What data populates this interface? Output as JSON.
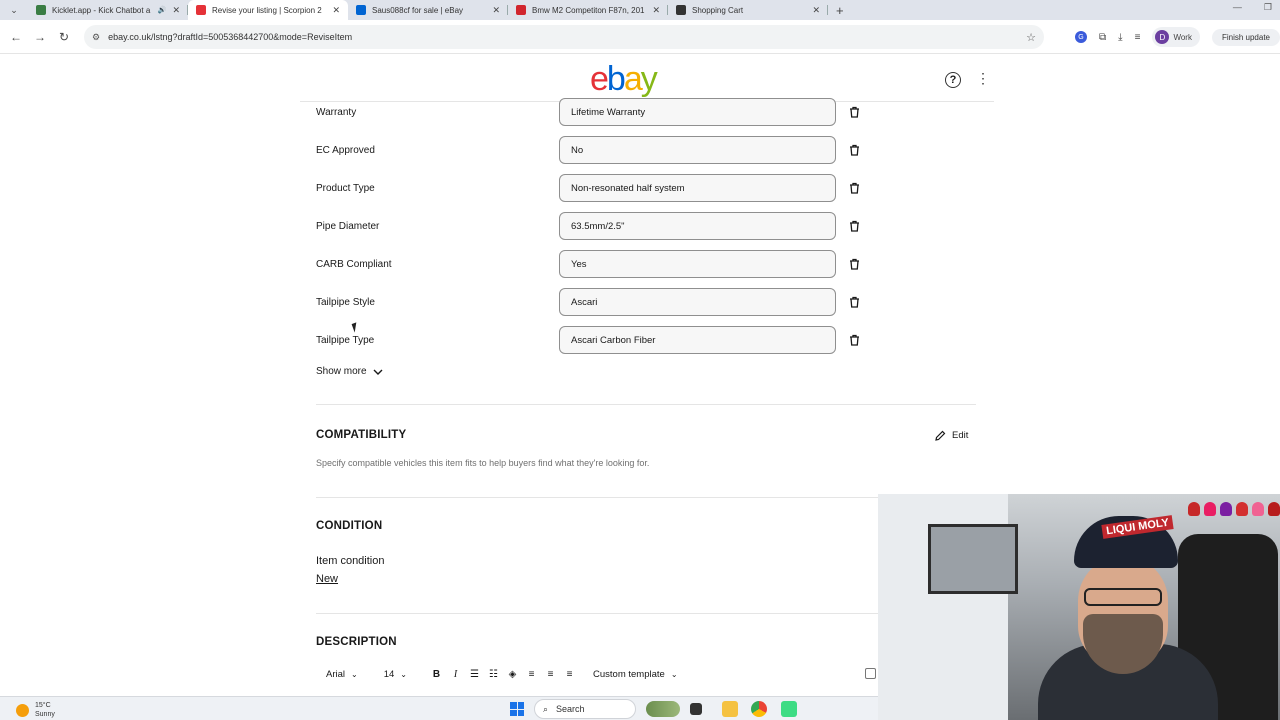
{
  "browser": {
    "tabs": [
      {
        "title": "Kicklet.app - Kick Chatbot a",
        "favicon_color": "#3a7d44",
        "active": false,
        "audio": true
      },
      {
        "title": "Revise your listing | Scorpion 2",
        "favicon_color": "#e53238",
        "active": true,
        "audio": false
      },
      {
        "title": "Saus088cf for sale | eBay",
        "favicon_color": "#0064d2",
        "active": false,
        "audio": false
      },
      {
        "title": "Bmw M2 Competiton F87n, 201",
        "favicon_color": "#d1252d",
        "active": false,
        "audio": false
      },
      {
        "title": "Shopping Cart",
        "favicon_color": "#333333",
        "active": false,
        "audio": false
      }
    ],
    "url": "ebay.co.uk/lstng?draftId=5005368442700&mode=ReviseItem",
    "profile_initial": "D",
    "profile_label": "Work",
    "finish_update": "Finish update"
  },
  "header": {
    "logo_letters": [
      "e",
      "b",
      "a",
      "y"
    ],
    "help_icon": "?",
    "menu_icon": "⋮"
  },
  "item_specifics": [
    {
      "label": "Warranty",
      "value": "Lifetime Warranty"
    },
    {
      "label": "EC Approved",
      "value": "No"
    },
    {
      "label": "Product Type",
      "value": "Non-resonated half system"
    },
    {
      "label": "Pipe Diameter",
      "value": "63.5mm/2.5\""
    },
    {
      "label": "CARB Compliant",
      "value": "Yes"
    },
    {
      "label": "Tailpipe Style",
      "value": "Ascari"
    },
    {
      "label": "Tailpipe Type",
      "value": "Ascari Carbon Fiber"
    }
  ],
  "show_more": "Show more",
  "compatibility": {
    "title": "COMPATIBILITY",
    "edit": "Edit",
    "description": "Specify compatible vehicles this item fits to help buyers find what they're looking for."
  },
  "condition": {
    "title": "CONDITION",
    "label": "Item condition",
    "value": "New"
  },
  "description": {
    "title": "DESCRIPTION",
    "font": "Arial",
    "size": "14",
    "template": "Custom template"
  },
  "webcam": {
    "cap_text": "LIQUI MOLY"
  },
  "taskbar": {
    "temperature": "15°C",
    "weather": "Sunny",
    "search_placeholder": "Search"
  }
}
